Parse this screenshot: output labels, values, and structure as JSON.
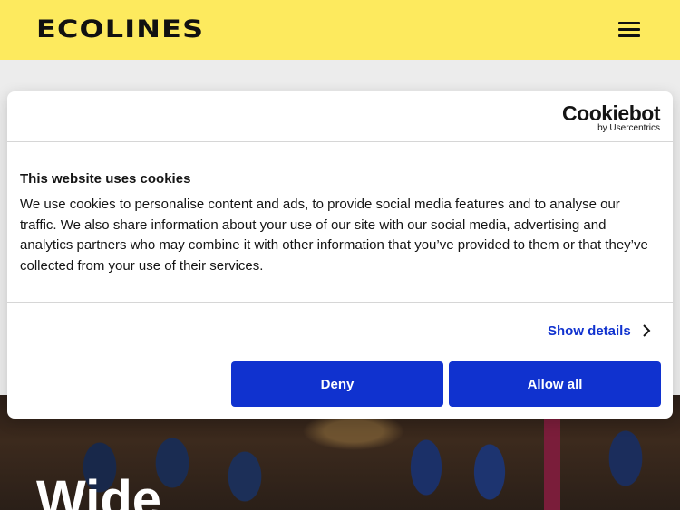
{
  "header": {
    "logo_text": "ECOLINES",
    "menu_icon": "hamburger-menu-icon"
  },
  "hero": {
    "title": "Wide"
  },
  "cookie_dialog": {
    "brand_name": "Cookiebot",
    "brand_sub": "by Usercentrics",
    "title": "This website uses cookies",
    "body": "We use cookies to personalise content and ads, to provide social media features and to analyse our traffic. We also share information about your use of our site with our social media, advertising and analytics partners who may combine it with other information that you’ve provided to them or that they’ve collected from your use of their services.",
    "show_details": "Show details",
    "chevron_icon": "chevron-right-icon",
    "deny_label": "Deny",
    "allow_label": "Allow all"
  },
  "colors": {
    "header_bg": "#fdea5e",
    "button_bg": "#1032cf",
    "link": "#1032cf"
  }
}
